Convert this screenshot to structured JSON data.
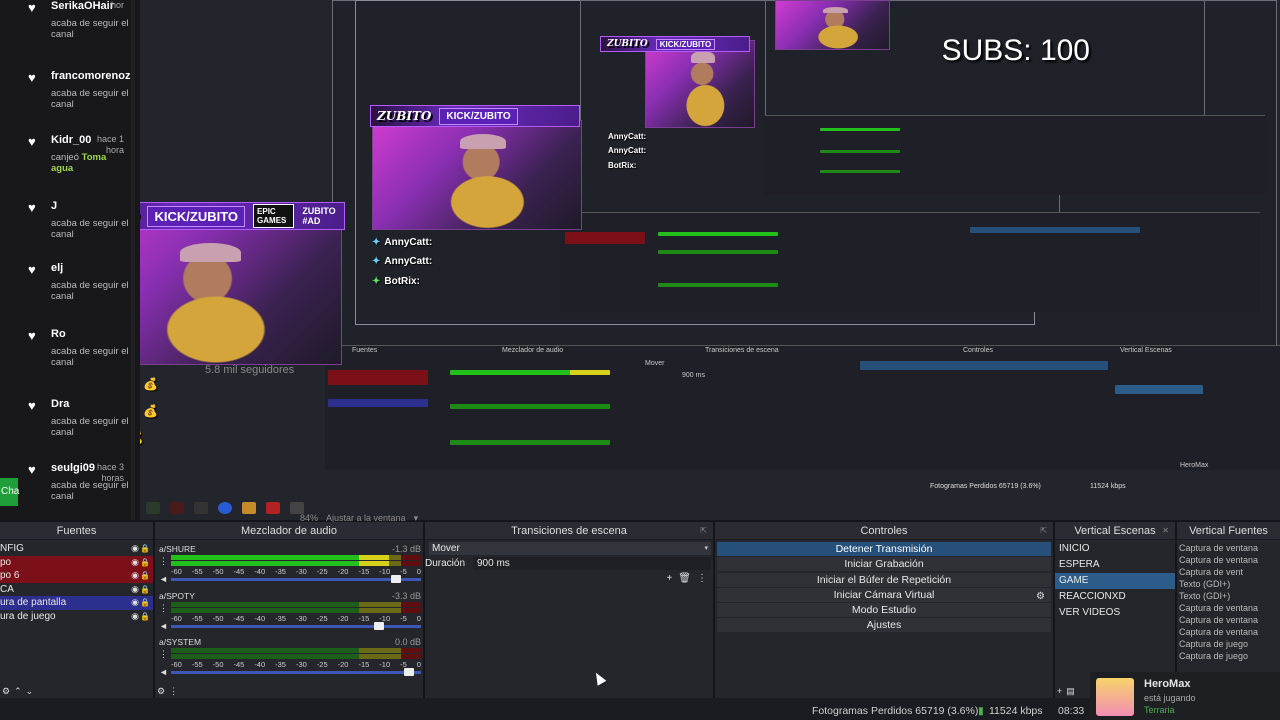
{
  "chat": {
    "messages": [
      {
        "user": "SerikaOHair",
        "time": "hor",
        "action": "acaba de seguir el canal",
        "reward": ""
      },
      {
        "user": "francomorenoz",
        "time": "",
        "action": "acaba de seguir el canal",
        "reward": ""
      },
      {
        "user": "Kidr_00",
        "time": "hace 1 hora",
        "action": "canjeó",
        "reward": "Toma agua"
      },
      {
        "user": "J",
        "time": "",
        "action": "acaba de seguir el canal",
        "reward": ""
      },
      {
        "user": "elj",
        "time": "",
        "action": "acaba de seguir el canal",
        "reward": ""
      },
      {
        "user": "Ro",
        "time": "",
        "action": "acaba de seguir el canal",
        "reward": ""
      },
      {
        "user": "Dra",
        "time": "",
        "action": "acaba de seguir el canal",
        "reward": ""
      },
      {
        "user": "seulgi09",
        "time": "hace 3 horas",
        "action": "acaba de seguir el canal",
        "reward": ""
      }
    ],
    "side_tab": "Cha"
  },
  "overlay": {
    "logo": "ZUBITO",
    "kick": "KICK/ZUBITO",
    "epic": "EPIC GAMES",
    "tag": "ZUBITO #AD",
    "followers": "5.8 mil seguidores",
    "subs": "SUBS: 100",
    "alerts": [
      "AnnyCatt:",
      "AnnyCatt:",
      "BotRix:"
    ]
  },
  "preview": {
    "zoom": "84%",
    "fit": "Ajustar a la ventana"
  },
  "docks": {
    "sources": {
      "title": "Fuentes",
      "items": [
        {
          "label": "NFIG",
          "style": ""
        },
        {
          "label": "po",
          "style": "red"
        },
        {
          "label": "po 6",
          "style": "red"
        },
        {
          "label": "CA",
          "style": ""
        },
        {
          "label": "ura de pantalla",
          "style": "blue"
        },
        {
          "label": "ura de juego",
          "style": ""
        }
      ]
    },
    "mixer": {
      "title": "Mezclador de audio",
      "channels": [
        {
          "name": "a/SHURE",
          "db": "-1.3 dB",
          "level": 0.87,
          "volume": 0.92
        },
        {
          "name": "a/SPOTY",
          "db": "-3.3 dB",
          "level": 0.0,
          "volume": 0.85
        },
        {
          "name": "a/SYSTEM",
          "db": "0.0 dB",
          "level": 0.0,
          "volume": 0.97
        }
      ],
      "scale": [
        "-60",
        "-55",
        "-50",
        "-45",
        "-40",
        "-35",
        "-30",
        "-25",
        "-20",
        "-15",
        "-10",
        "-5",
        "0"
      ]
    },
    "transitions": {
      "title": "Transiciones de escena",
      "selected": "Mover",
      "duration_label": "Duración",
      "duration": "900 ms"
    },
    "controls": {
      "title": "Controles",
      "buttons": [
        "Detener Transmisión",
        "Iniciar Grabación",
        "Iniciar el Búfer de Repetición",
        "Iniciar Cámara Virtual",
        "Modo Estudio",
        "Ajustes"
      ]
    },
    "scenes": {
      "title": "Vertical Escenas",
      "items": [
        "INICIO",
        "ESPERA",
        "GAME",
        "REACCIONXD",
        "VER VIDEOS"
      ],
      "selected": "GAME"
    },
    "vsources": {
      "title": "Vertical Fuentes",
      "items": [
        "Captura de ventana",
        "Captura de ventana",
        "Captura de vent",
        "Texto (GDI+)",
        "Texto (GDI+)",
        "Captura de ventana",
        "Captura de ventana",
        "Captura de ventana",
        "Captura de juego",
        "Captura de juego"
      ]
    }
  },
  "status": {
    "frames": "Fotogramas Perdidos 65719 (3.6%)",
    "kbps": "11524 kbps",
    "time": "08:33"
  },
  "hero": {
    "name": "HeroMax",
    "status": "está jugando",
    "game": "Terraria"
  },
  "colors": {
    "meter_green": "#22c01a",
    "meter_yellow": "#d6d21a",
    "meter_red": "#c21515",
    "accent_blue": "#2b5c8a",
    "source_red": "#7c1018",
    "source_blue": "#2d2f8e"
  }
}
